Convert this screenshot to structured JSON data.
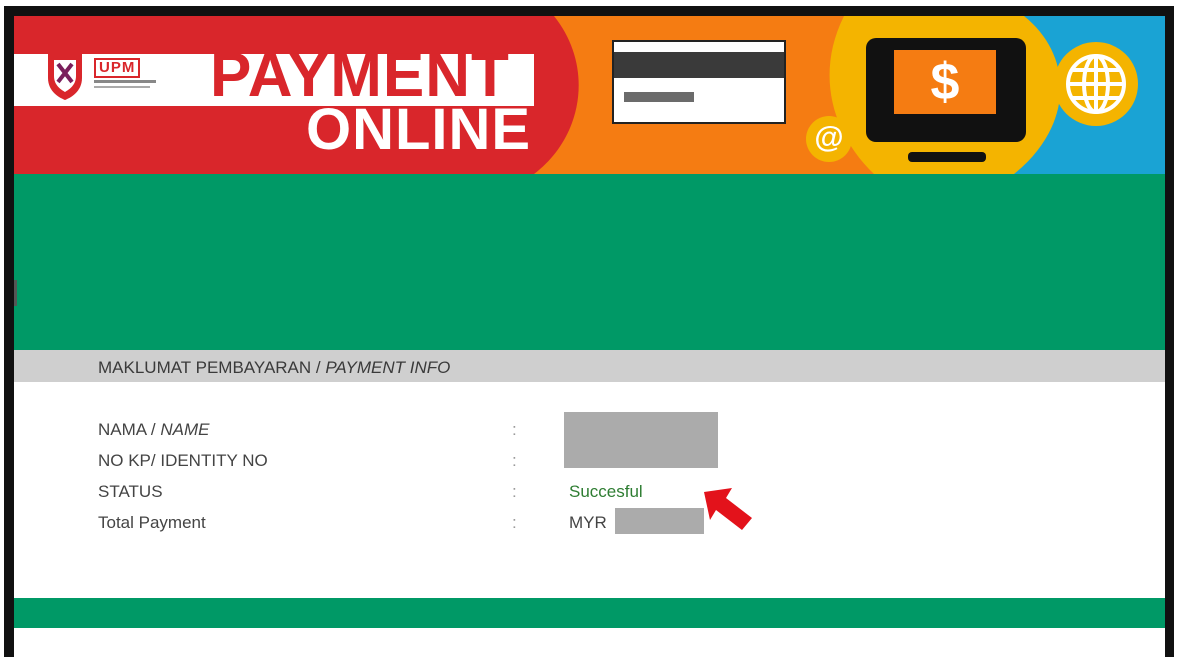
{
  "banner": {
    "logo_text": "UPM",
    "title_line1": "PAYMENT",
    "title_line2": "ONLINE",
    "at_symbol": "@",
    "dollar_symbol": "$"
  },
  "colors": {
    "brand_red": "#d9262b",
    "brand_green": "#009966",
    "accent_orange": "#f57c12",
    "accent_yellow": "#f4b400",
    "accent_blue": "#1aa3d4",
    "status_green": "#2e7d32"
  },
  "section": {
    "title_plain": "MAKLUMAT PEMBAYARAN / ",
    "title_italic": "PAYMENT INFO"
  },
  "rows": [
    {
      "label_plain": "NAMA / ",
      "label_italic": "NAME",
      "colon": ":",
      "value": ""
    },
    {
      "label_plain": "NO KP/ IDENTITY NO",
      "label_italic": "",
      "colon": ":",
      "value": ""
    },
    {
      "label_plain": "STATUS",
      "label_italic": "",
      "colon": ":",
      "value": "Succesful"
    },
    {
      "label_plain": "Total Payment",
      "label_italic": "",
      "colon": ":",
      "value": "MYR"
    }
  ],
  "icons": {
    "logo": "upm-crest-icon",
    "card": "credit-card-icon",
    "at": "at-sign-icon",
    "monitor": "monitor-dollar-icon",
    "globe": "globe-icon",
    "arrow": "red-arrow-icon"
  }
}
